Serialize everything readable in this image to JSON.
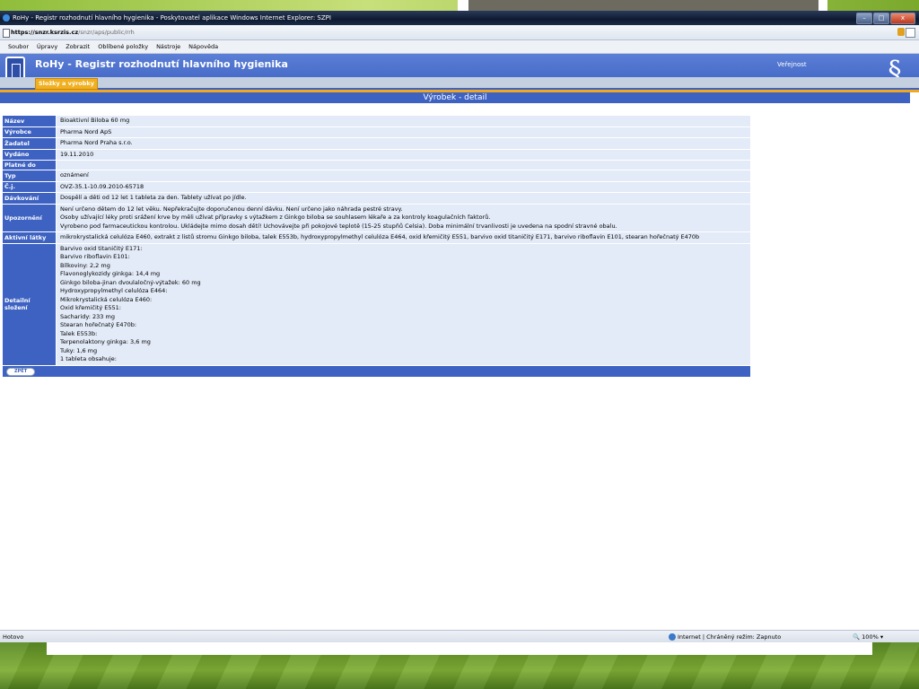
{
  "window": {
    "title": "RoHy - Registr rozhodnutí hlavního hygienika - Poskytovatel aplikace Windows Internet Explorer: SZPI",
    "controls": [
      "–",
      "□",
      "x"
    ]
  },
  "address": {
    "host": "https://snzr.ksrzis.cz",
    "path": "/snzr/aps/public/rrh"
  },
  "menu": [
    "Soubor",
    "Úpravy",
    "Zobrazit",
    "Oblíbené položky",
    "Nástroje",
    "Nápověda"
  ],
  "app": {
    "title": "RoHy - Registr rozhodnutí hlavního hygienika",
    "tab": "Složky a výrobky",
    "role": "Veřejnost",
    "emblem": "§"
  },
  "section_title": "Výrobek - detail",
  "rows": [
    {
      "label": "Název",
      "value": "Bioaktivní Biloba 60 mg"
    },
    {
      "label": "Výrobce",
      "value": "Pharma Nord ApS"
    },
    {
      "label": "Žadatel",
      "value": "Pharma Nord Praha s.r.o."
    },
    {
      "label": "Vydáno",
      "value": "19.11.2010"
    },
    {
      "label": "Platné do",
      "value": ""
    },
    {
      "label": "Typ",
      "value": "oznámení"
    },
    {
      "label": "Č.j.",
      "value": "OVZ-35.1-10.09.2010-65718"
    },
    {
      "label": "Dávkování",
      "value": "Dospělí a děti od 12 let 1 tableta za den. Tablety užívat po jídle."
    },
    {
      "label": "Upozornění",
      "value": "Není určeno dětem do 12 let věku. Nepřekračujte doporučenou denní dávku. Není určeno jako náhrada pestré stravy.\nOsoby užívající léky proti srážení krve by měli užívat přípravky s výtažkem z Ginkgo biloba se souhlasem lékaře a za kontroly koagulačních faktorů.\nVyrobeno pod farmaceutickou kontrolou. Ukládejte mimo dosah dětí! Uchovávejte při pokojové teplotě (15-25 stupňů Celsia). Doba minimální trvanlivosti je uvedena na spodní stravné obalu."
    },
    {
      "label": "Aktivní látky",
      "value": "mikrokrystalická celulóza E460, extrakt z listů stromu Ginkgo biloba, talek E553b, hydroxypropylmethyl celulóza E464, oxid křemičitý E551, barvivo oxid titaničitý E171, barvivo riboflavin E101, stearan hořečnatý E470b"
    },
    {
      "label": "Detailní složení",
      "value": "Barvivo oxid titaničitý E171:\nBarvivo riboflavin E101:\nBílkoviny: 2,2 mg\nFlavonoglykozidy ginkga: 14,4 mg\nGinkgo biloba-jinan dvoulaločný-výtažek: 60 mg\nHydroxypropylmethyl celulóza E464:\nMikrokrystalická celulóza E460:\nOxid křemičitý E551:\nSacharidy: 233 mg\nStearan hořečnatý E470b:\nTalek E553b:\nTerpenolaktony ginkga: 3,6 mg\nTuky: 1,6 mg\n1 tableta obsahuje:"
    }
  ],
  "back_label": "ZPĚT",
  "status": {
    "left": "Hotovo",
    "zone": "Internet | Chráněný režim: Zapnuto",
    "zoom": "100%"
  },
  "colors": {
    "header_blue": "#3d62c2",
    "value_bg": "#e3ebf8",
    "accent_orange": "#f0a820"
  }
}
